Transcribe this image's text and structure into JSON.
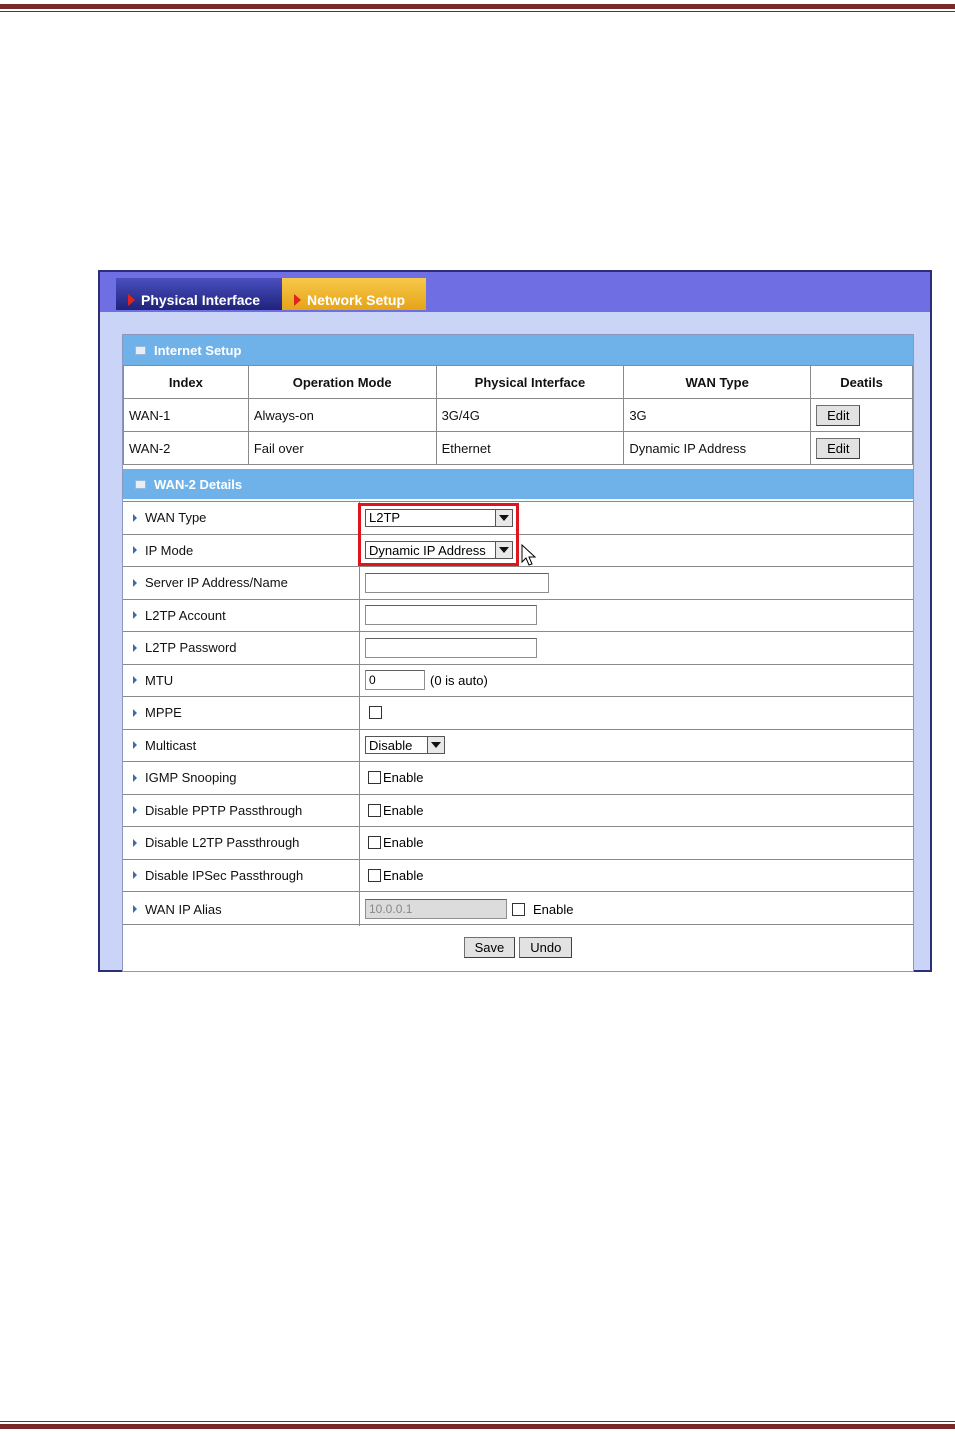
{
  "tabs": {
    "physical": "Physical Interface",
    "network": "Network Setup"
  },
  "internet_setup": {
    "title": "Internet Setup",
    "columns": [
      "Index",
      "Operation Mode",
      "Physical Interface",
      "WAN Type",
      "Deatils"
    ],
    "rows": [
      {
        "index": "WAN-1",
        "mode": "Always-on",
        "iface": "3G/4G",
        "wan_type": "3G",
        "action": "Edit"
      },
      {
        "index": "WAN-2",
        "mode": "Fail over",
        "iface": "Ethernet",
        "wan_type": "Dynamic IP Address",
        "action": "Edit"
      }
    ]
  },
  "details": {
    "title": "WAN-2 Details",
    "wan_type": {
      "label": "WAN Type",
      "value": "L2TP"
    },
    "ip_mode": {
      "label": "IP Mode",
      "value": "Dynamic IP Address"
    },
    "server": {
      "label": "Server IP Address/Name",
      "value": ""
    },
    "account": {
      "label": "L2TP Account",
      "value": ""
    },
    "password": {
      "label": "L2TP Password",
      "value": ""
    },
    "mtu": {
      "label": "MTU",
      "value": "0",
      "hint": "(0 is auto)"
    },
    "mppe": {
      "label": "MPPE"
    },
    "multicast": {
      "label": "Multicast",
      "value": "Disable"
    },
    "igmp": {
      "label": "IGMP Snooping",
      "option": "Enable"
    },
    "pptp": {
      "label": "Disable PPTP Passthrough",
      "option": "Enable"
    },
    "l2tp": {
      "label": "Disable L2TP Passthrough",
      "option": "Enable"
    },
    "ipsec": {
      "label": "Disable IPSec Passthrough",
      "option": "Enable"
    },
    "alias": {
      "label": "WAN IP Alias",
      "value": "10.0.0.1",
      "option": "Enable"
    }
  },
  "buttons": {
    "save": "Save",
    "undo": "Undo"
  },
  "colors": {
    "highlight": "#e0141b",
    "section_bar": "#6fb2ea",
    "frame": "#6f6fe3"
  }
}
